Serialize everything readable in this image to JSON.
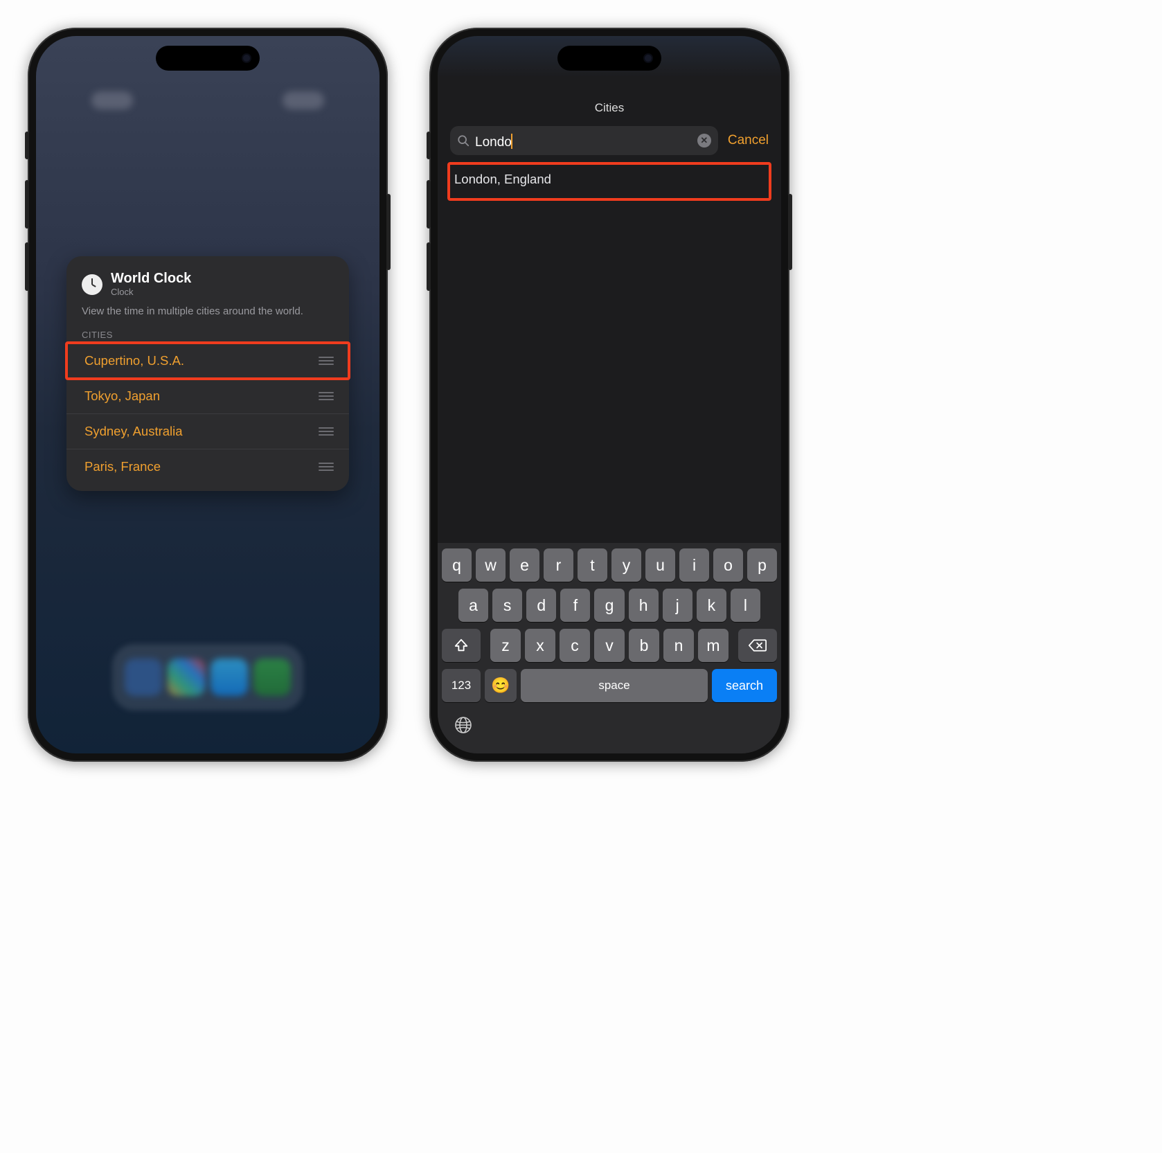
{
  "phone1": {
    "widget": {
      "title": "World Clock",
      "subtitle": "Clock",
      "description": "View the time in multiple cities around the world.",
      "section_label": "CITIES",
      "cities": [
        "Cupertino, U.S.A.",
        "Tokyo, Japan",
        "Sydney, Australia",
        "Paris, France"
      ]
    }
  },
  "phone2": {
    "header_title": "Cities",
    "search": {
      "value": "Londo",
      "cancel_label": "Cancel"
    },
    "results": [
      "London, England"
    ],
    "keyboard": {
      "row1": [
        "q",
        "w",
        "e",
        "r",
        "t",
        "y",
        "u",
        "i",
        "o",
        "p"
      ],
      "row2": [
        "a",
        "s",
        "d",
        "f",
        "g",
        "h",
        "j",
        "k",
        "l"
      ],
      "row3": [
        "z",
        "x",
        "c",
        "v",
        "b",
        "n",
        "m"
      ],
      "numbers_label": "123",
      "space_label": "space",
      "search_label": "search"
    }
  }
}
